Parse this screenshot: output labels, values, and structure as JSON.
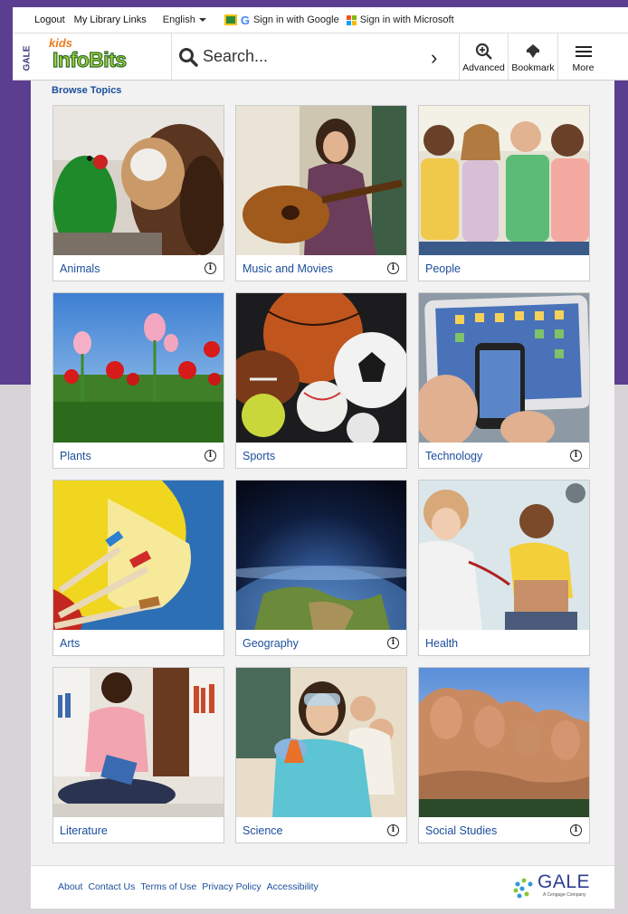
{
  "topbar": {
    "logout": "Logout",
    "library_links": "My Library Links",
    "language": "English",
    "google_signin": "Sign in with Google",
    "microsoft_signin": "Sign in with Microsoft"
  },
  "logo": {
    "gale": "GALE",
    "kids": "kids",
    "infobits": "InfoBits"
  },
  "search": {
    "placeholder": "Search..."
  },
  "nav": {
    "advanced": "Advanced",
    "bookmark": "Bookmark",
    "more": "More"
  },
  "browse": {
    "heading": "Browse Topics"
  },
  "topics": [
    {
      "label": "Animals",
      "info": true
    },
    {
      "label": "Music and Movies",
      "info": true
    },
    {
      "label": "People",
      "info": false
    },
    {
      "label": "Plants",
      "info": true
    },
    {
      "label": "Sports",
      "info": false
    },
    {
      "label": "Technology",
      "info": true
    },
    {
      "label": "Arts",
      "info": false
    },
    {
      "label": "Geography",
      "info": true
    },
    {
      "label": "Health",
      "info": false
    },
    {
      "label": "Literature",
      "info": false
    },
    {
      "label": "Science",
      "info": true
    },
    {
      "label": "Social Studies",
      "info": true
    }
  ],
  "footer": {
    "links": [
      "About",
      "Contact Us",
      "Terms of Use",
      "Privacy Policy",
      "Accessibility"
    ],
    "brand": "GALE",
    "brand_sub": "A Cengage Company"
  },
  "colors": {
    "accent_purple": "#5b3e8f",
    "link_blue": "#1b4e9b"
  }
}
